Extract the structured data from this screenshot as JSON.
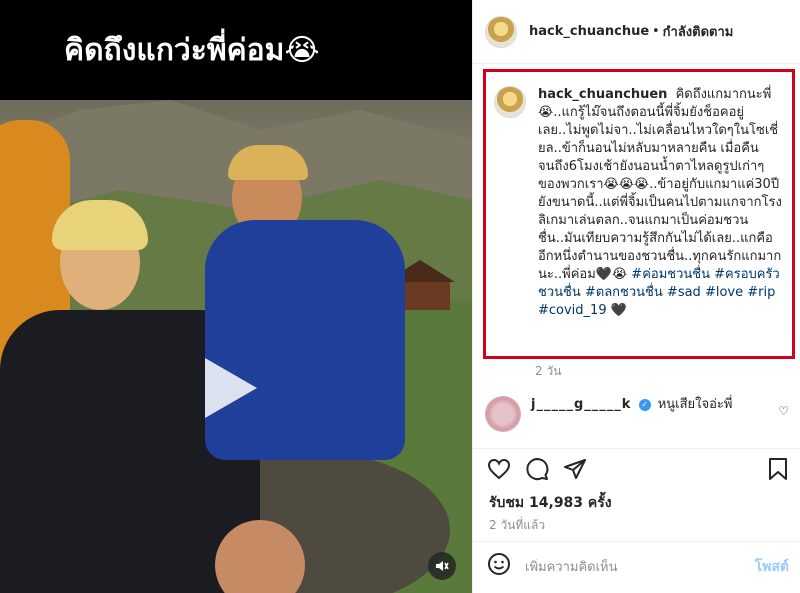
{
  "media": {
    "overlay_caption": "คิดถึงแกว่ะพี่ค่อม😭",
    "mute_icon": "mute-icon"
  },
  "header": {
    "username": "hack_chuanchuen",
    "separator": "•",
    "follow_status": "กำลังติดตาม"
  },
  "caption": {
    "username": "hack_chuanchuen",
    "text": "คิดถึงแกมากนะพี่😭..แกรู้ไม๊จนถึงตอนนี้พี่จิ้มยังช็อคอยู่เลย..ไม่พูดไม่จา..ไม่เคลื่อนไหวใดๆในโซเชี่ยล..ข้าก็นอนไม่หลับมาหลายคืน เมื่อคืนจนถึง6โมงเช้ายังนอนน้ำตาไหลดูรูปเก่าๆของพวกเรา😭😭😭..ข้าอยู่กับแกมาแค่30ปียังขนาดนี้..แต่พี่จิ้มเป็นคนไปตามแกจากโรงลิเกมาเล่นตลก..จนแกมาเป็นค่อมชวนชื่น..มันเทียบความรู้สึกกันไม่ได้เลย..แกคืออีกหนึ่งตำนานของชวนชื่น..ทุกคนรักแกมากนะ..พี่ค่อม🖤😭",
    "hashtags": [
      "#ค่อมชวนชื่น",
      "#ครอบครัวชวนชื่น",
      "#ตลกชวนชื่น",
      "#sad",
      "#love",
      "#rip",
      "#covid_19"
    ],
    "ending": "🖤",
    "time": "2 วัน"
  },
  "comment": {
    "username": "j_____g_____k",
    "text": "หนูเสียใจอ่ะพี่"
  },
  "actions": {
    "like_icon": "heart-icon",
    "comment_icon": "comment-icon",
    "share_icon": "share-icon",
    "save_icon": "bookmark-icon"
  },
  "stats": {
    "views_label": "รับชม",
    "views_count": "14,983",
    "views_suffix": "ครั้ง",
    "post_date": "2 วันที่แล้ว"
  },
  "comment_input": {
    "placeholder": "เพิ่มความคิดเห็น",
    "post_label": "โพสต์"
  }
}
